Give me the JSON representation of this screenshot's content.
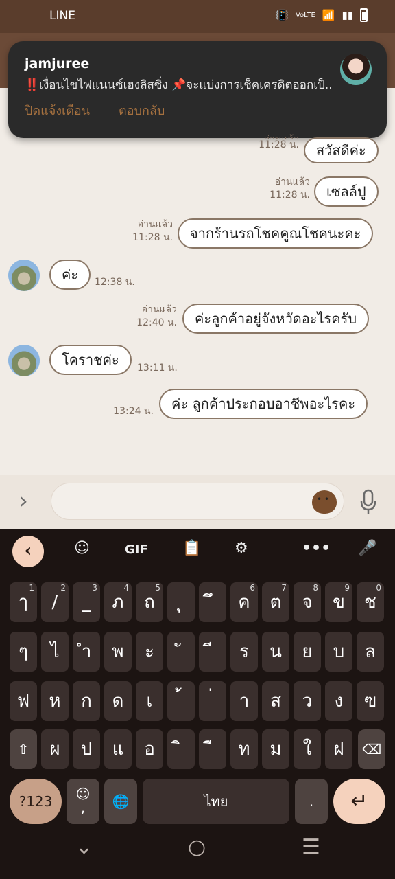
{
  "status": {
    "app_name": "LINE"
  },
  "notification": {
    "sender": "jamjuree",
    "message": "‼️เงื่อนไขไฟแนนซ์เฮงลิสซิ่ง 📌จะแบ่งการเช็คเครดิตออกเป็..",
    "action_dismiss": "ปิดแจ้งเตือน",
    "action_reply": "ตอบกลับ"
  },
  "messages": [
    {
      "side": "out",
      "text": "สวัสดีค่ะ",
      "status": "อ่านแล้ว",
      "time": "11:28 น."
    },
    {
      "side": "out",
      "text": "เซลล์ปู",
      "status": "อ่านแล้ว",
      "time": "11:28 น."
    },
    {
      "side": "out",
      "text": "จากร้านรถโชคคูณโชคนะคะ",
      "status": "อ่านแล้ว",
      "time": "11:28 น."
    },
    {
      "side": "in",
      "text": "ค่ะ",
      "time": "12:38 น."
    },
    {
      "side": "out",
      "text": "ค่ะลูกค้าอยู่จังหวัดอะไรครับ",
      "status": "อ่านแล้ว",
      "time": "12:40 น."
    },
    {
      "side": "in",
      "text": "โคราชค่ะ",
      "time": "13:11 น."
    },
    {
      "side": "out",
      "text": "ค่ะ ลูกค้าประกอบอาชีพอะไรคะ",
      "time": "13:24 น."
    }
  ],
  "input": {
    "value": "",
    "placeholder": ""
  },
  "keyboard": {
    "toolbar_gif": "GIF",
    "space_label": "ไทย",
    "numbers_label": "?123",
    "period_label": ".",
    "row1": [
      {
        "k": "ๅ",
        "n": "1"
      },
      {
        "k": "/",
        "n": "2"
      },
      {
        "k": "_",
        "n": "3"
      },
      {
        "k": "ภ",
        "n": "4"
      },
      {
        "k": "ถ",
        "n": "5"
      },
      {
        "k": "ุ",
        "n": ""
      },
      {
        "k": "ึ",
        "n": ""
      },
      {
        "k": "ค",
        "n": "6"
      },
      {
        "k": "ต",
        "n": "7"
      },
      {
        "k": "จ",
        "n": "8"
      },
      {
        "k": "ข",
        "n": "9"
      },
      {
        "k": "ช",
        "n": "0"
      }
    ],
    "row2": [
      "ๆ",
      "ไ",
      "ำ",
      "พ",
      "ะ",
      "ั",
      "ี",
      "ร",
      "น",
      "ย",
      "บ",
      "ล"
    ],
    "row3": [
      "ฟ",
      "ห",
      "ก",
      "ด",
      "เ",
      "้",
      "่",
      "า",
      "ส",
      "ว",
      "ง",
      "ฃ"
    ],
    "row4": [
      "ผ",
      "ป",
      "แ",
      "อ",
      "ิ",
      "ื",
      "ท",
      "ม",
      "ใ",
      "ฝ"
    ]
  }
}
